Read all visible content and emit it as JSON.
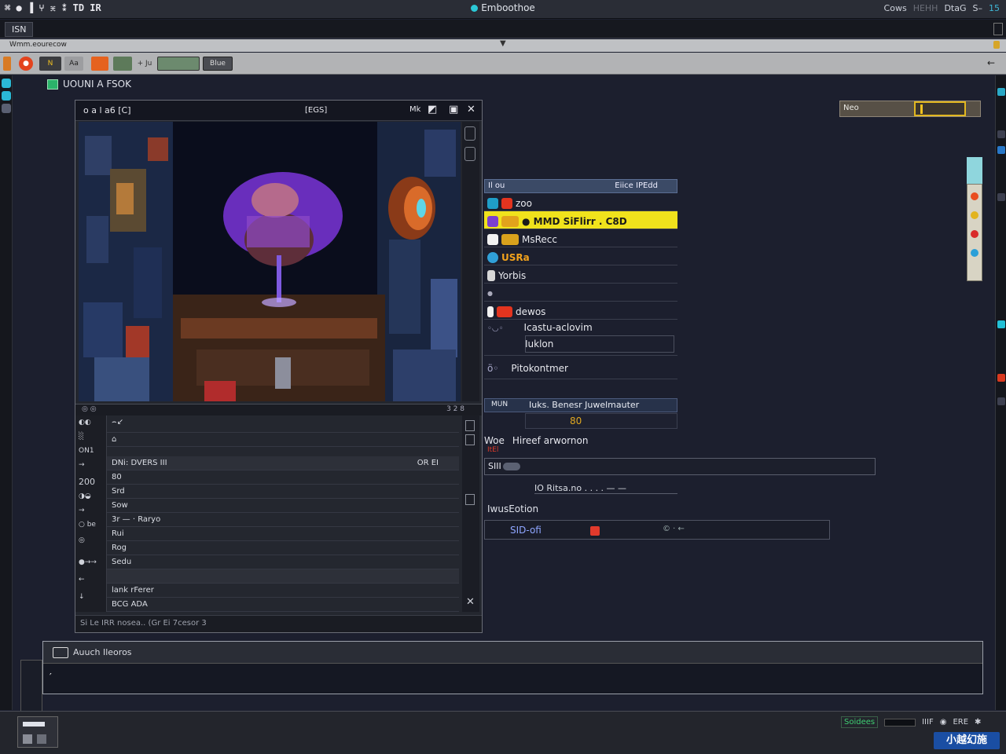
{
  "titlebar": {
    "left_label": "⌘ ● ▐ ⑂ ⁜ ⁑ TD IR",
    "app_title": "Emboothoe",
    "right_items": [
      "Cows",
      "HEHH",
      "DtaG",
      "S–",
      "15"
    ]
  },
  "tab": {
    "label": "ISN"
  },
  "pathbar": {
    "path": "Wmm.eourecow"
  },
  "toolbar": {
    "t3": "N",
    "t4": "Aa",
    "t7": "+ Ju",
    "t9": "Blue"
  },
  "breadcrumb": {
    "label": "UOUNI A FSOK"
  },
  "viewer": {
    "title": "o a l a6  [C]",
    "center_label": "[EGS]",
    "controls": [
      "Mk",
      "◩",
      "▣",
      "✕"
    ],
    "lower_header_right": "3 2 8",
    "gutter_labels": [
      "◐◐",
      "░",
      "ON1",
      "→",
      "200",
      "◑◒",
      "→",
      "○ be",
      "◎",
      "●→→",
      "←",
      "↓"
    ],
    "rows": [
      {
        "text": "⌢↙",
        "right": ""
      },
      {
        "text": "⌂",
        "right": ""
      },
      {
        "text": "DNi: DVERS   III",
        "right": "OR EI"
      },
      {
        "text": "80",
        "right": ""
      },
      {
        "text": "Srd",
        "right": ""
      },
      {
        "text": "Sow",
        "right": ""
      },
      {
        "text": "3r  — · Raryo",
        "right": ""
      },
      {
        "text": "Rui",
        "right": ""
      },
      {
        "text": "Rog",
        "right": ""
      },
      {
        "text": "Sedu",
        "right": ""
      },
      {
        "text": "",
        "right": ""
      },
      {
        "text": "lank rFerer",
        "right": ""
      },
      {
        "text": "BCG  ADA",
        "right": ""
      }
    ],
    "footer": "Si  Le IRR nosea..  (Gr Ei 7cesor 3"
  },
  "list_panel": {
    "header_left": "Il ou",
    "header_right": "Eiice IPEdd",
    "items": [
      {
        "label": "zoo",
        "chip1": "#1f9ec8",
        "chip2": "#e3341f",
        "selected": false
      },
      {
        "label": "● MMD SiFlirr . C8D",
        "chip1": "#7c3fcf",
        "chip2": "#e2a21c",
        "selected": true
      },
      {
        "label": "MsRecc",
        "chip1": "#f2f2f2",
        "chip2": "#d9a21c",
        "selected": false
      },
      {
        "label": "USRa",
        "chip1": "#30a0d8",
        "chip2": "#e3341f",
        "selected": false
      },
      {
        "label": "Yorbis",
        "chip1": "#f2f2f2",
        "chip2": "",
        "selected": false
      },
      {
        "label": "●",
        "chip1": "",
        "chip2": "",
        "selected": false
      },
      {
        "label": "dewos",
        "chip1": "#f2f2f2",
        "chip2": "#e3341f",
        "selected": false
      }
    ],
    "tall_item": {
      "left": "◦◡◦",
      "label": "Icastu-aclovim",
      "sub": "Iuklon"
    },
    "item_after": {
      "icon": "ö◦",
      "label": "Pitokontmer"
    },
    "blue_row": {
      "a": "MUN",
      "b": "Iuks. Benesr Juwelmauter"
    },
    "number": "80",
    "row2": {
      "left": "Woe",
      "left_red": "ItEl",
      "label": "Hireef arwornon"
    },
    "field": {
      "value": "SIII"
    },
    "note": "IO Ritsa.no . . . . — —",
    "section": "IwusEotion",
    "field2": {
      "value": "SID-ofi",
      "tiny": "© · ←"
    }
  },
  "search": {
    "label": "Neo"
  },
  "console": {
    "title": "Auuch Ileoros",
    "prompt": "′"
  },
  "statusbar": {
    "green_label": "Soidees",
    "items": [
      "IIIF",
      "◉",
      "ERE",
      "✱"
    ],
    "logo": "小越幻施"
  }
}
